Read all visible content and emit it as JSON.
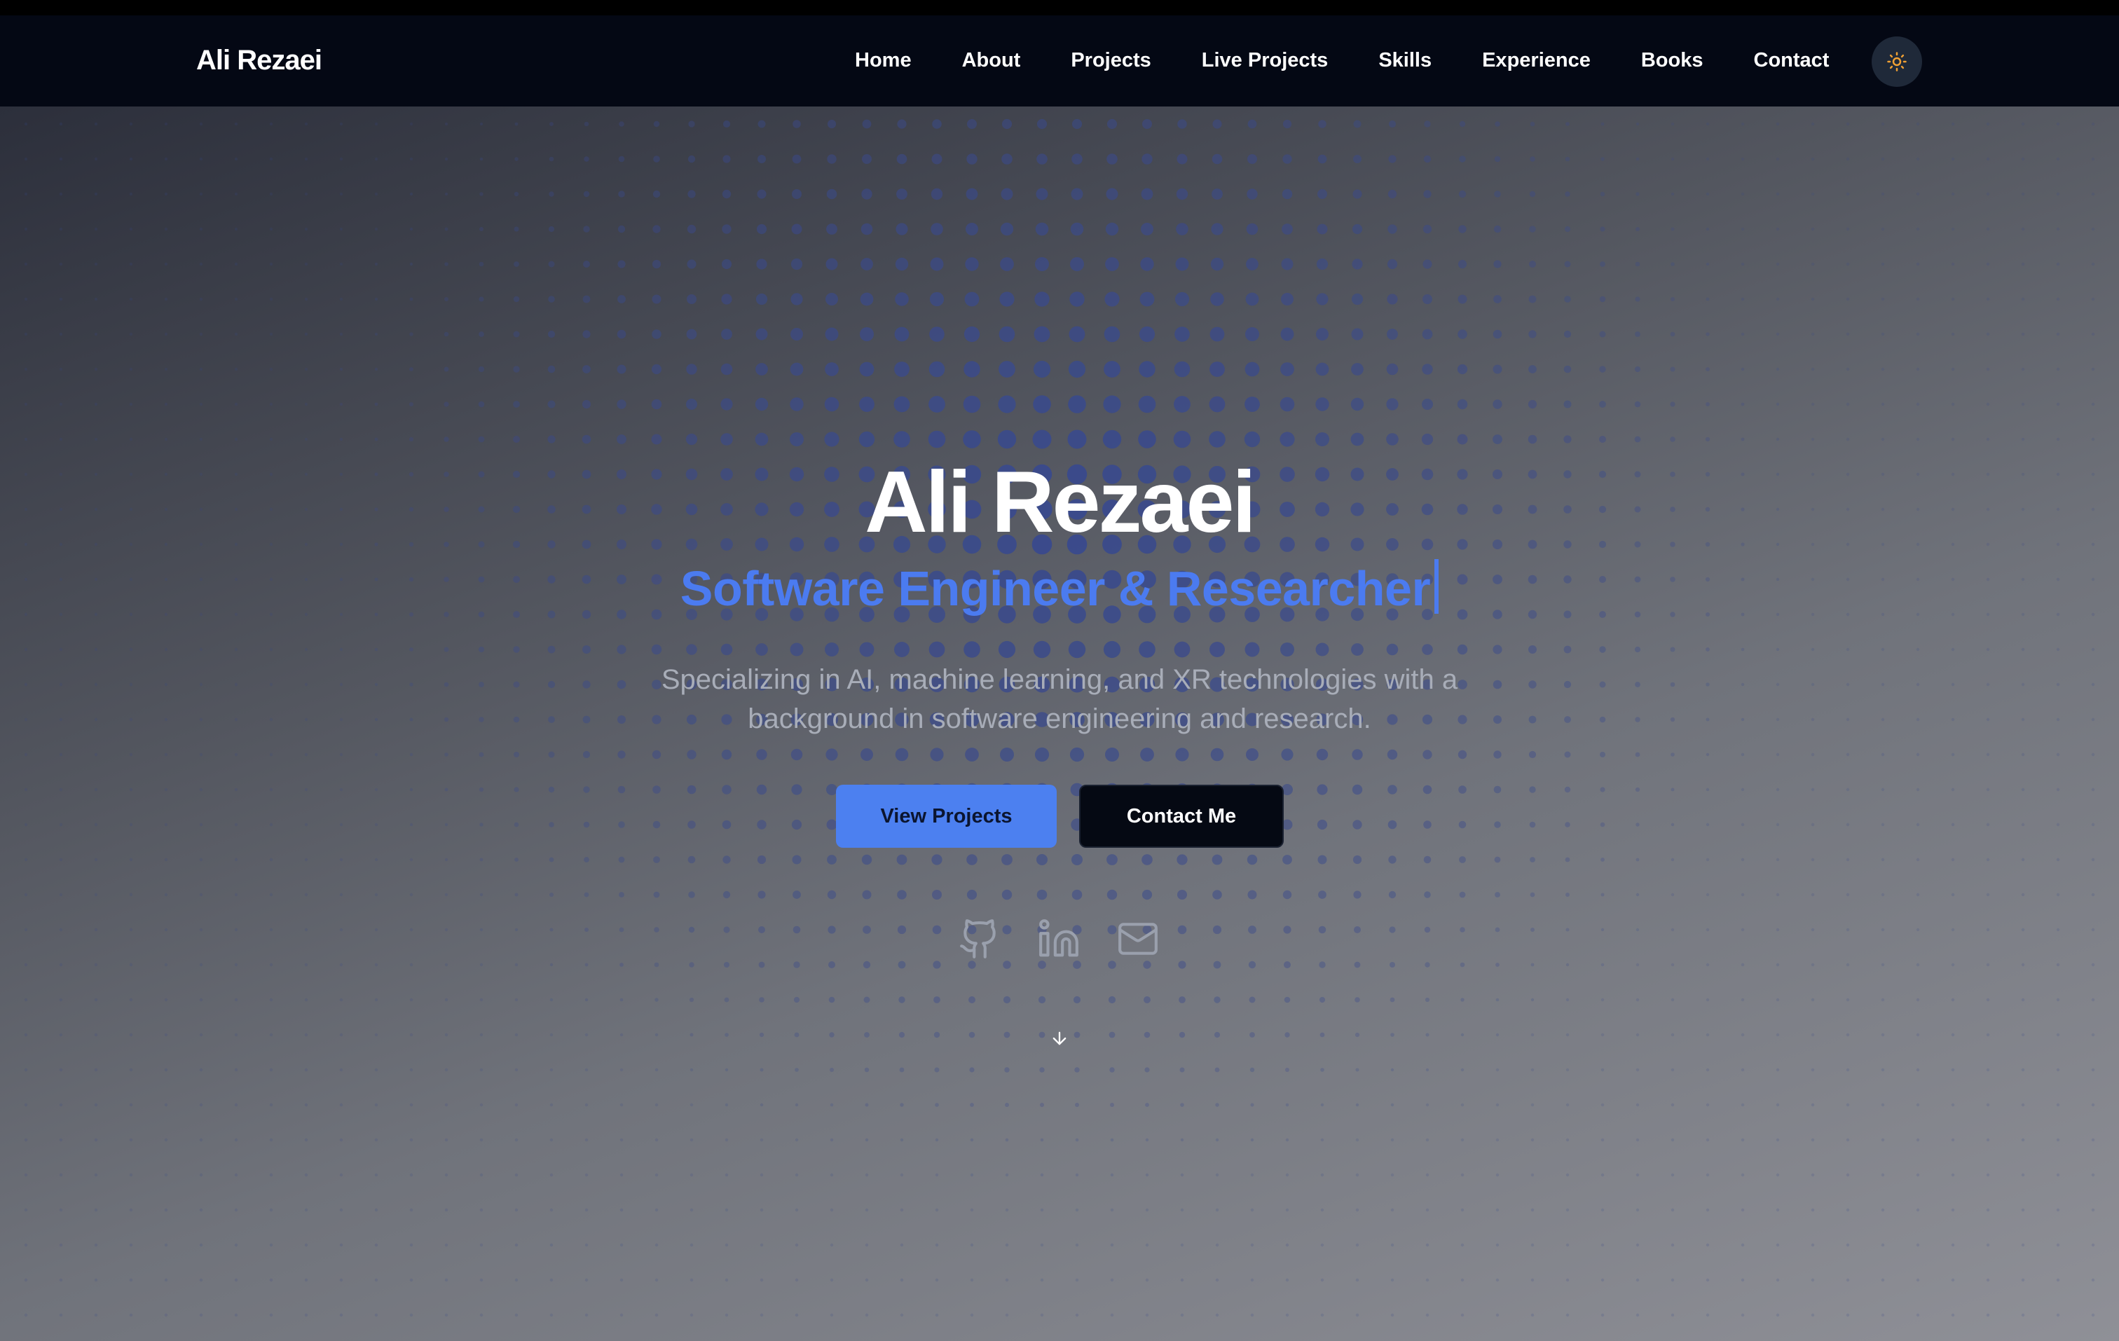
{
  "nav": {
    "brand": "Ali Rezaei",
    "links": [
      {
        "label": "Home"
      },
      {
        "label": "About"
      },
      {
        "label": "Projects"
      },
      {
        "label": "Live Projects"
      },
      {
        "label": "Skills"
      },
      {
        "label": "Experience"
      },
      {
        "label": "Books"
      },
      {
        "label": "Contact"
      }
    ],
    "theme_toggle_icon": "sun-icon"
  },
  "hero": {
    "title": "Ali Rezaei",
    "subtitle": "Software Engineer & Researcher",
    "description": "Specializing in AI, machine learning, and XR technologies with a background in software engineering and research.",
    "primary_button": "View Projects",
    "secondary_button": "Contact Me",
    "social_icons": [
      "github-icon",
      "linkedin-icon",
      "mail-icon"
    ],
    "scroll_icon": "arrow-down-icon"
  },
  "colors": {
    "navbar_bg": "#040814",
    "accent": "#4c80f0",
    "dot": "#3a4a8c",
    "sun": "#f0a033",
    "icon": "#9aa0ad"
  }
}
